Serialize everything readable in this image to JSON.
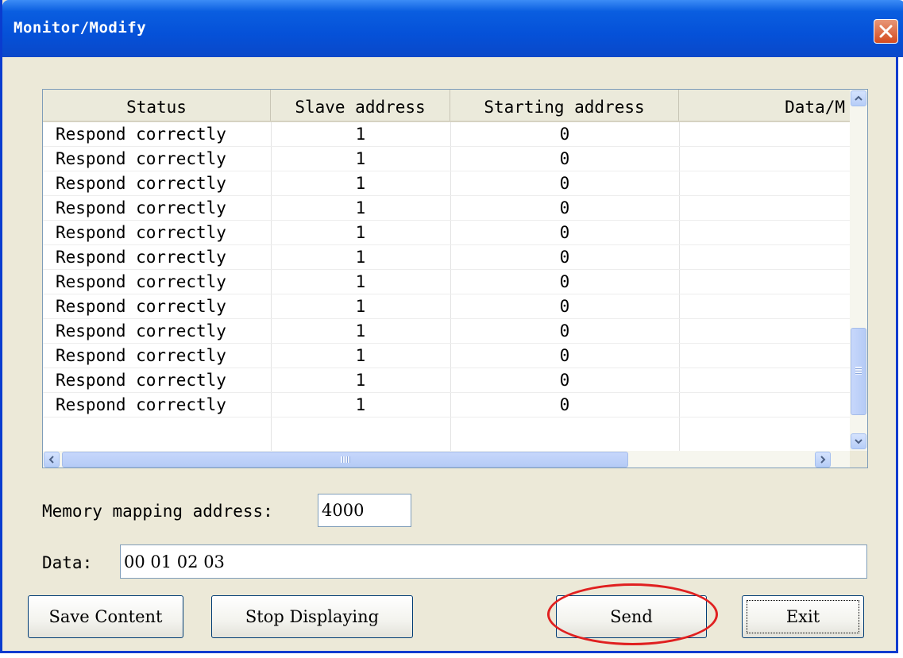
{
  "window": {
    "title": "Monitor/Modify"
  },
  "table": {
    "columns": [
      "Status",
      "Slave address",
      "Starting address",
      "Data/M"
    ],
    "rows": [
      [
        "Respond correctly",
        "1",
        "0"
      ],
      [
        "Respond correctly",
        "1",
        "0"
      ],
      [
        "Respond correctly",
        "1",
        "0"
      ],
      [
        "Respond correctly",
        "1",
        "0"
      ],
      [
        "Respond correctly",
        "1",
        "0"
      ],
      [
        "Respond correctly",
        "1",
        "0"
      ],
      [
        "Respond correctly",
        "1",
        "0"
      ],
      [
        "Respond correctly",
        "1",
        "0"
      ],
      [
        "Respond correctly",
        "1",
        "0"
      ],
      [
        "Respond correctly",
        "1",
        "0"
      ],
      [
        "Respond correctly",
        "1",
        "0"
      ],
      [
        "Respond correctly",
        "1",
        "0"
      ]
    ]
  },
  "form": {
    "memory_label": "Memory mapping address:",
    "memory_value": "4000",
    "data_label": "Data:",
    "data_value": "00 01 02 03"
  },
  "buttons": {
    "save": "Save Content",
    "stop": "Stop Displaying",
    "send": "Send",
    "exit": "Exit"
  },
  "annotation": {
    "highlight_color": "#e02020",
    "highlights": "send-button"
  },
  "icons": [
    "close-icon",
    "scroll-up-icon",
    "scroll-down-icon",
    "scroll-left-icon",
    "scroll-right-icon"
  ]
}
